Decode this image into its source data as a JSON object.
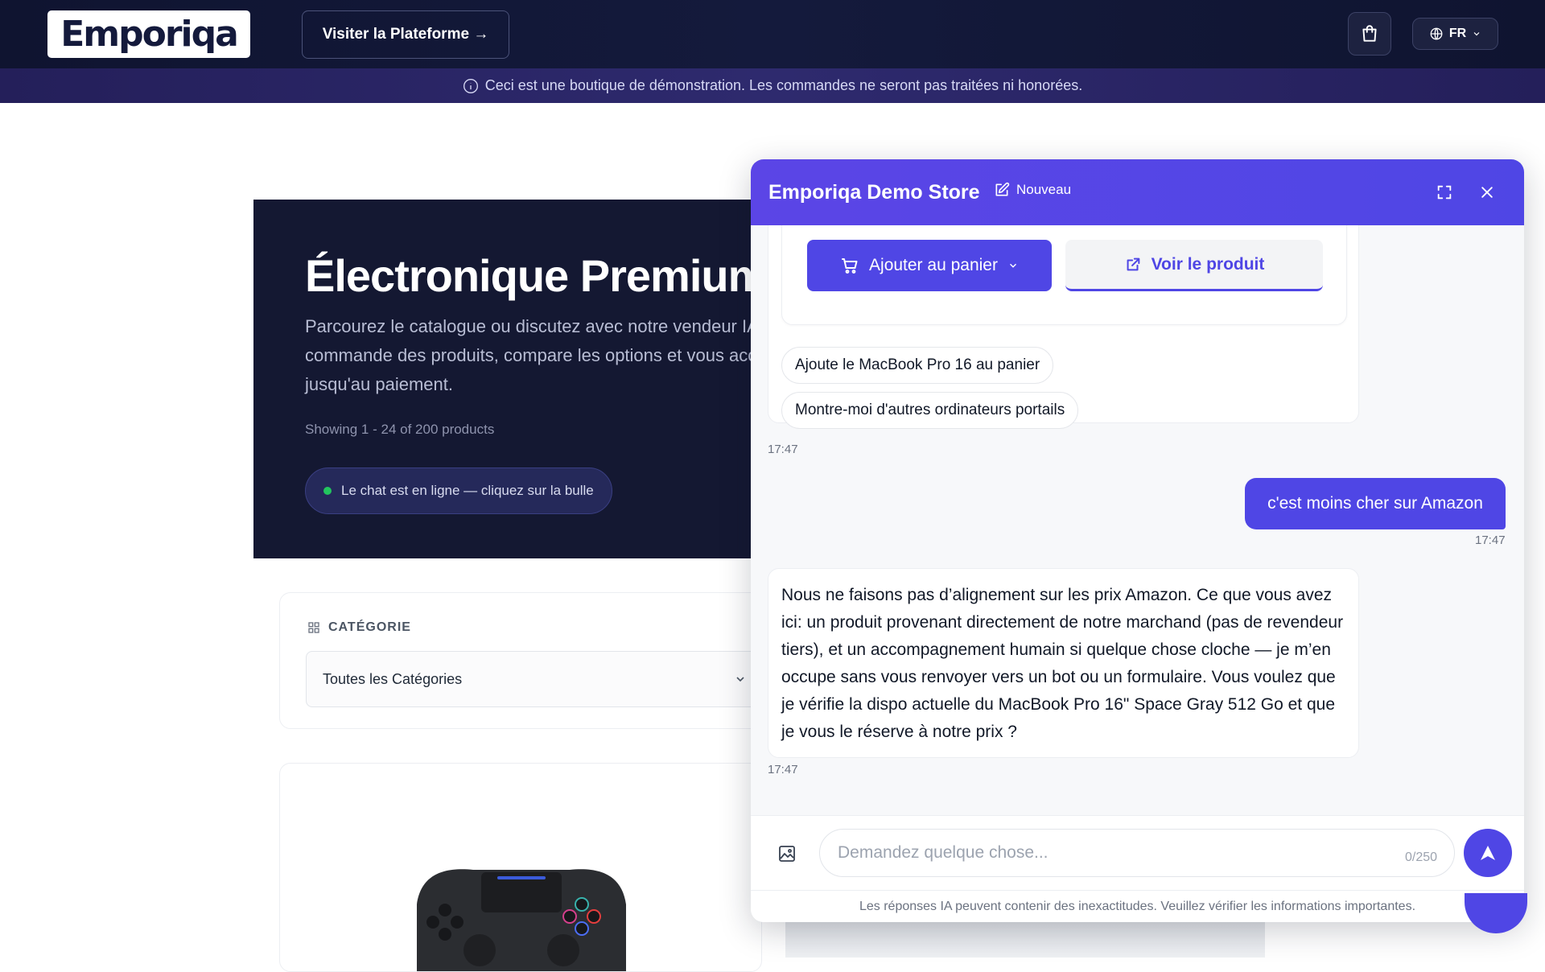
{
  "header": {
    "logo_text": "Emporiqa",
    "visit_label": "Visiter la Plateforme →",
    "lang_label": "FR"
  },
  "banner": {
    "text": "Ceci est une boutique de démonstration. Les commandes ne seront pas traitées ni honorées."
  },
  "hero": {
    "title": "Électronique Premium",
    "description": "Parcourez le catalogue ou discutez avec notre vendeur IA qui commande des produits, compare les options et vous accompagne jusqu'au paiement.",
    "count": "Showing 1 - 24 of 200 products",
    "pill": "Le chat est en ligne — cliquez sur la bulle"
  },
  "category": {
    "label": "CATÉGORIE",
    "selected": "Toutes les Catégories"
  },
  "chat": {
    "title": "Emporiqa Demo Store",
    "new_label": "Nouveau",
    "add_to_cart": "Ajouter au panier",
    "view_product": "Voir le produit",
    "suggestions": [
      "Ajoute le MacBook Pro 16 au panier",
      "Montre-moi d'autres ordinateurs portails"
    ],
    "messages": [
      {
        "role": "bot",
        "time": "17:47"
      },
      {
        "role": "user",
        "text": "c'est moins cher sur Amazon",
        "time": "17:47"
      },
      {
        "role": "bot",
        "text": "Nous ne faisons pas d’alignement sur les prix Amazon. Ce que vous avez ici: un produit provenant directement de notre marchand (pas de revendeur tiers), et un accompagnement humain si quelque chose cloche — je m’en occupe sans vous renvoyer vers un bot ou un formulaire. Vous voulez que je vérifie la dispo actuelle du MacBook Pro 16\" Space Gray 512 Go et que je vous le réserve à notre prix ?",
        "time": "17:47"
      }
    ],
    "input_placeholder": "Demandez quelque chose...",
    "char_count": "0/250",
    "disclaimer": "Les réponses IA peuvent contenir des inexactitudes. Veuillez vérifier les informations importantes."
  },
  "colors": {
    "accent": "#4f46e5",
    "navbar": "#0f1430",
    "hero_bg": "#141832"
  }
}
